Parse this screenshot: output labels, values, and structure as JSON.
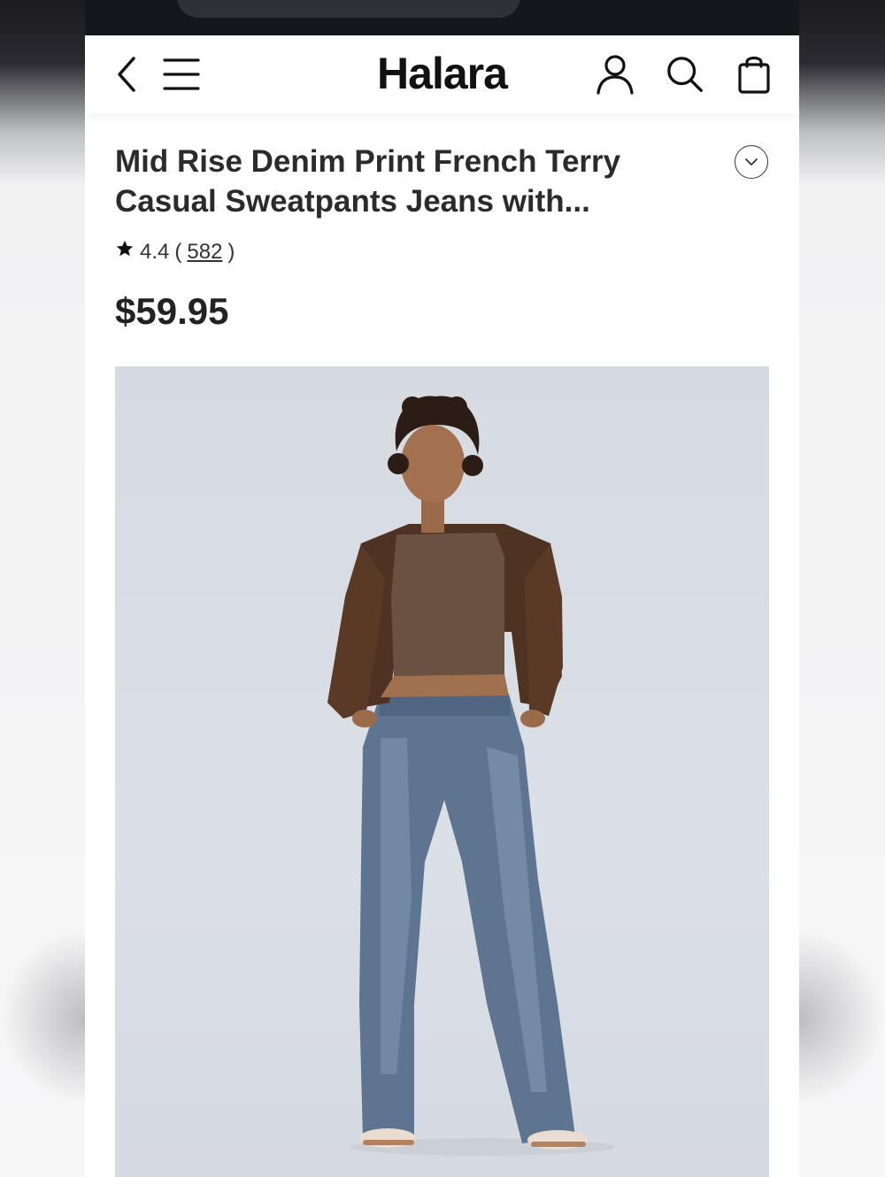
{
  "header": {
    "logo": "Halara",
    "back_icon": "chevron-left-icon",
    "menu_icon": "hamburger-menu-icon",
    "account_icon": "user-icon",
    "search_icon": "search-icon",
    "bag_icon": "shopping-bag-icon"
  },
  "product": {
    "title": "Mid Rise Denim Print French Terry Casual Sweatpants Jeans with...",
    "rating": "4.4",
    "rating_open": "(",
    "review_count": "582",
    "rating_close": ")",
    "price": "$59.95",
    "expand_icon": "chevron-down-icon",
    "image": "model-photo"
  },
  "colors": {
    "browser_bar": "#15171c",
    "text_dark": "#2b2b2b",
    "image_bg": "#d8dde3"
  }
}
